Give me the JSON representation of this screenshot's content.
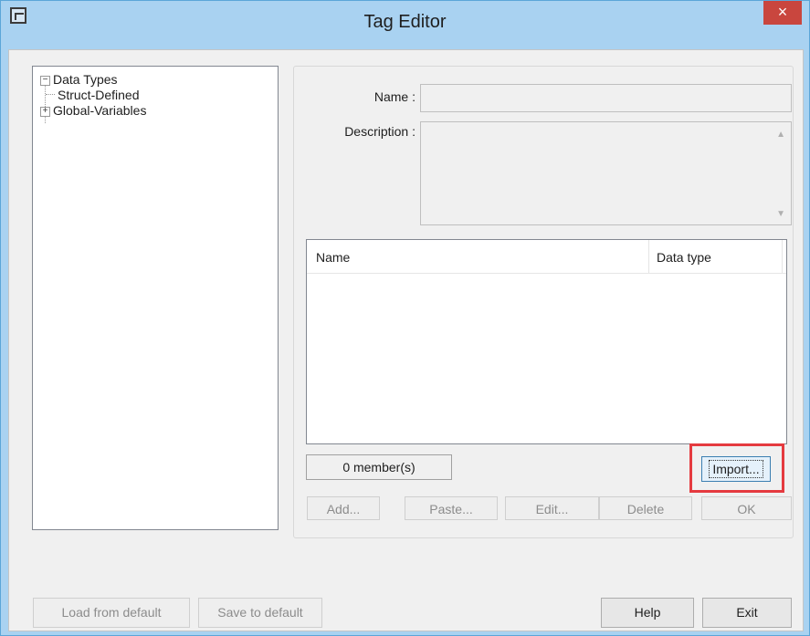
{
  "window": {
    "title": "Tag Editor",
    "close_glyph": "×",
    "app_icon": "app-icon"
  },
  "tree": {
    "root": "Data Types",
    "root_expander": "−",
    "children": [
      {
        "label": "Struct-Defined"
      },
      {
        "label": "Global-Variables",
        "expander": "+"
      }
    ]
  },
  "form": {
    "name_label": "Name :",
    "name_value": "",
    "description_label": "Description :",
    "description_value": "",
    "scroll_up": "▲",
    "scroll_down": "▼"
  },
  "members_table": {
    "columns": [
      "Name",
      "Data type"
    ],
    "rows": [],
    "count_text": "0 member(s)"
  },
  "buttons": {
    "import": "Import...",
    "add": "Add...",
    "paste": "Paste...",
    "edit": "Edit...",
    "delete": "Delete",
    "ok": "OK",
    "load_default": "Load from default",
    "save_default": "Save to default",
    "help": "Help",
    "exit": "Exit"
  },
  "colors": {
    "highlight": "#e53a3f",
    "titlebar": "#a9d2f1",
    "close": "#c9463e"
  }
}
